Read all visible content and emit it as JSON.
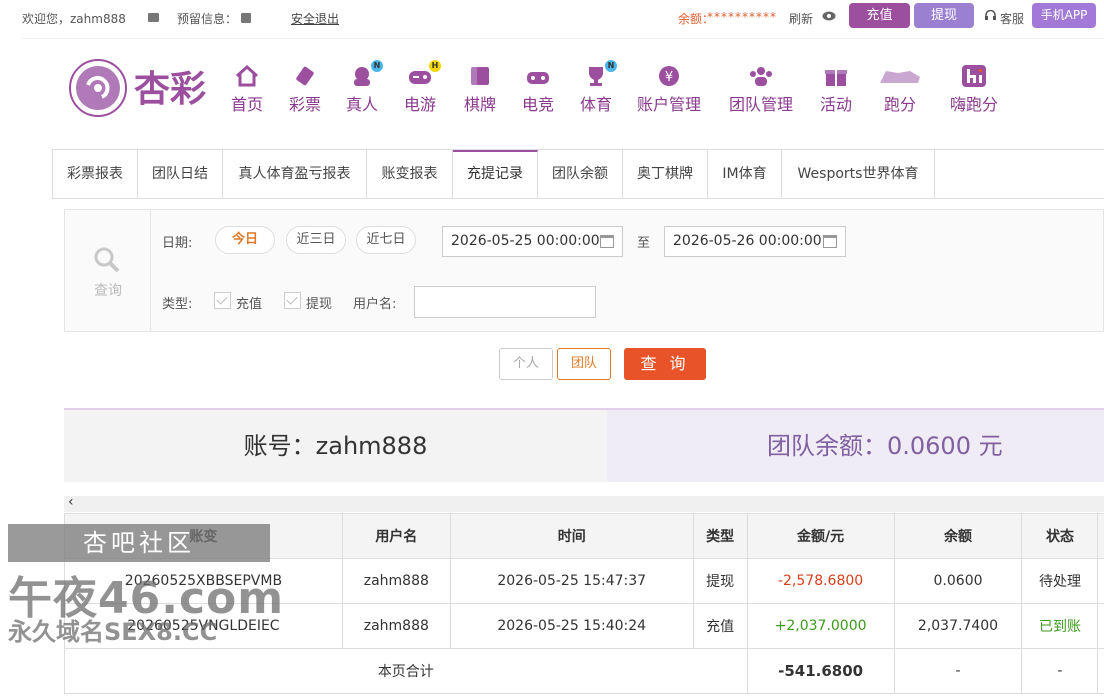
{
  "topbar": {
    "welcome": "欢迎您，zahm888",
    "reserve_label": "预留信息：",
    "logout": "安全退出",
    "balance_label": "余额：",
    "balance_value": "**********",
    "refresh": "刷新",
    "recharge": "充值",
    "withdraw": "提现",
    "service": "客服",
    "app": "手机APP"
  },
  "header": {
    "brand": "杏彩",
    "nav": [
      {
        "label": "首页",
        "icon": "home-icon"
      },
      {
        "label": "彩票",
        "icon": "lottery-ticket-icon"
      },
      {
        "label": "真人",
        "icon": "live-dealer-icon",
        "badge": "N"
      },
      {
        "label": "电游",
        "icon": "gamepad-icon",
        "badge": "H"
      },
      {
        "label": "棋牌",
        "icon": "cards-icon"
      },
      {
        "label": "电竞",
        "icon": "esports-controller-icon"
      },
      {
        "label": "体育",
        "icon": "trophy-icon",
        "badge": "N"
      },
      {
        "label": "账户管理",
        "icon": "yen-coin-icon"
      },
      {
        "label": "团队管理",
        "icon": "team-icon"
      },
      {
        "label": "活动",
        "icon": "gift-icon"
      },
      {
        "label": "跑分",
        "icon": "rhino-icon"
      },
      {
        "label": "嗨跑分",
        "icon": "hi-icon"
      }
    ]
  },
  "tabs": [
    "彩票报表",
    "团队日结",
    "真人体育盈亏报表",
    "账变报表",
    "充提记录",
    "团队余额",
    "奥丁棋牌",
    "IM体育",
    "Wesports世界体育"
  ],
  "active_tab": "充提记录",
  "filter": {
    "query_label": "查询",
    "date_label": "日期:",
    "ranges": [
      "今日",
      "近三日",
      "近七日"
    ],
    "active_range": "今日",
    "date_from": "2026-05-25 00:00:00",
    "to_label": "至",
    "date_to": "2026-05-26 00:00:00",
    "type_label": "类型:",
    "type_recharge": "充值",
    "type_withdraw": "提现",
    "username_label": "用户名:",
    "username_value": "",
    "personal": "个人",
    "team": "团队",
    "query_button": "查 询"
  },
  "summary": {
    "account": "账号：zahm888",
    "team_balance": "团队余额：0.0600 元"
  },
  "table": {
    "headers": [
      "账变",
      "用户名",
      "时间",
      "类型",
      "金额/元",
      "余额",
      "状态"
    ],
    "rows": [
      {
        "id": "20260525XBBSEPVMB",
        "user": "zahm888",
        "time": "2026-05-25 15:47:37",
        "type": "提现",
        "amount": "-2,578.6800",
        "balance": "0.0600",
        "status": "待处理"
      },
      {
        "id": "20260525VNGLDEIEC",
        "user": "zahm888",
        "time": "2026-05-25 15:40:24",
        "type": "充值",
        "amount": "+2,037.0000",
        "balance": "2,037.7400",
        "status": "已到账"
      }
    ],
    "total_label": "本页合计",
    "total_amount": "-541.6800",
    "total_balance": "-",
    "total_status": "-"
  },
  "watermark": {
    "line1": "杏吧社区",
    "line2": "午夜46.com",
    "line3": "永久域名SEX8.CC"
  },
  "colors": {
    "brand_purple": "#9b4f9e",
    "accent_orange": "#e8532a",
    "negative": "#d6401c",
    "positive": "#3c9a1c"
  }
}
